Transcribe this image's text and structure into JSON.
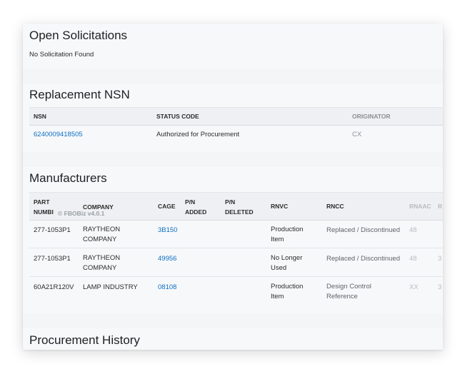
{
  "open_solicitations": {
    "title": "Open Solicitations",
    "message": "No Solicitation Found"
  },
  "replacement_nsn": {
    "title": "Replacement NSN",
    "headers": {
      "nsn": "NSN",
      "status_code": "STATUS CODE",
      "originator": "ORIGINATOR"
    },
    "rows": [
      {
        "nsn": "6240009418505",
        "status_code": "Authorized for Procurement",
        "originator": "CX"
      }
    ]
  },
  "manufacturers": {
    "title": "Manufacturers",
    "headers": {
      "part_number_1": "PART",
      "part_number_2": "NUMBI",
      "company": "COMPANY",
      "cage": "CAGE",
      "pn_added_1": "P/N",
      "pn_added_2": "ADDED",
      "pn_deleted_1": "P/N",
      "pn_deleted_2": "DELETED",
      "rnvc": "RNVC",
      "rncc": "RNCC",
      "rnaac": "RNAAC",
      "next": "R"
    },
    "rows": [
      {
        "part": "277-1053P1",
        "company_1": "RAYTHEON",
        "company_2": "COMPANY",
        "cage": "3B150",
        "rnvc_1": "Production",
        "rnvc_2": "Item",
        "rncc": "Replaced / Discontinued",
        "rnaac": "48",
        "next": ""
      },
      {
        "part": "277-1053P1",
        "company_1": "RAYTHEON",
        "company_2": "COMPANY",
        "cage": "49956",
        "rnvc_1": "No Longer",
        "rnvc_2": "Used",
        "rncc": "Replaced / Discontinued",
        "rnaac": "48",
        "next": "3"
      },
      {
        "part": "60A21R120V",
        "company_1": "LAMP INDUSTRY",
        "company_2": "",
        "cage": "08108",
        "rnvc_1": "Production",
        "rnvc_2": "Item",
        "rncc_1": "Design Control",
        "rncc_2": "Reference",
        "rnaac": "XX",
        "next": "3"
      }
    ]
  },
  "procurement_history": {
    "title": "Procurement History"
  },
  "watermark": "© FBOBiz v4.0.1"
}
